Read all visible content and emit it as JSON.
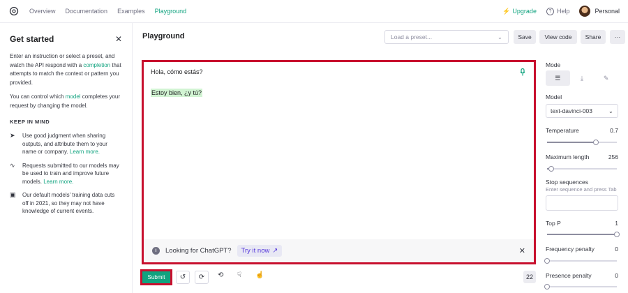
{
  "nav": {
    "links": [
      "Overview",
      "Documentation",
      "Examples",
      "Playground"
    ],
    "upgrade": "Upgrade",
    "help": "Help",
    "user": "Personal"
  },
  "sidebar": {
    "title": "Get started",
    "intro_a": "Enter an instruction or select a preset, and watch the API respond with a ",
    "intro_link": "completion",
    "intro_b": " that attempts to match the context or pattern you provided.",
    "model_a": "You can control which ",
    "model_link": "model",
    "model_b": " completes your request by changing the model.",
    "keep_in_mind": "KEEP IN MIND",
    "tips": [
      {
        "text": "Use good judgment when sharing outputs, and attribute them to your name or company. ",
        "link": "Learn more."
      },
      {
        "text": "Requests submitted to our models may be used to train and improve future models. ",
        "link": "Learn more."
      },
      {
        "text": "Our default models' training data cuts off in 2021, so they may not have knowledge of current events.",
        "link": ""
      }
    ]
  },
  "header": {
    "title": "Playground",
    "preset_placeholder": "Load a preset...",
    "save": "Save",
    "view_code": "View code",
    "share": "Share",
    "more": "···"
  },
  "editor": {
    "prompt": "Hola, cómo estás?",
    "completion": "Estoy bien, ¿y tú?",
    "banner_text": "Looking for ChatGPT?",
    "banner_link": "Try it now"
  },
  "toolbar": {
    "submit": "Submit",
    "token_count": "22"
  },
  "settings": {
    "mode_label": "Mode",
    "model_label": "Model",
    "model_value": "text-davinci-003",
    "temperature_label": "Temperature",
    "temperature_value": "0.7",
    "temperature_fraction": 0.7,
    "max_length_label": "Maximum length",
    "max_length_value": "256",
    "max_length_fraction": 0.06,
    "stop_label": "Stop sequences",
    "stop_hint": "Enter sequence and press Tab",
    "top_p_label": "Top P",
    "top_p_value": "1",
    "top_p_fraction": 1.0,
    "freq_label": "Frequency penalty",
    "freq_value": "0",
    "freq_fraction": 0.0,
    "presence_label": "Presence penalty",
    "presence_value": "0",
    "presence_fraction": 0.0
  },
  "colors": {
    "accent": "#10a37f",
    "highlight_border": "#c8102e",
    "completion_bg": "#d2f4d3"
  }
}
